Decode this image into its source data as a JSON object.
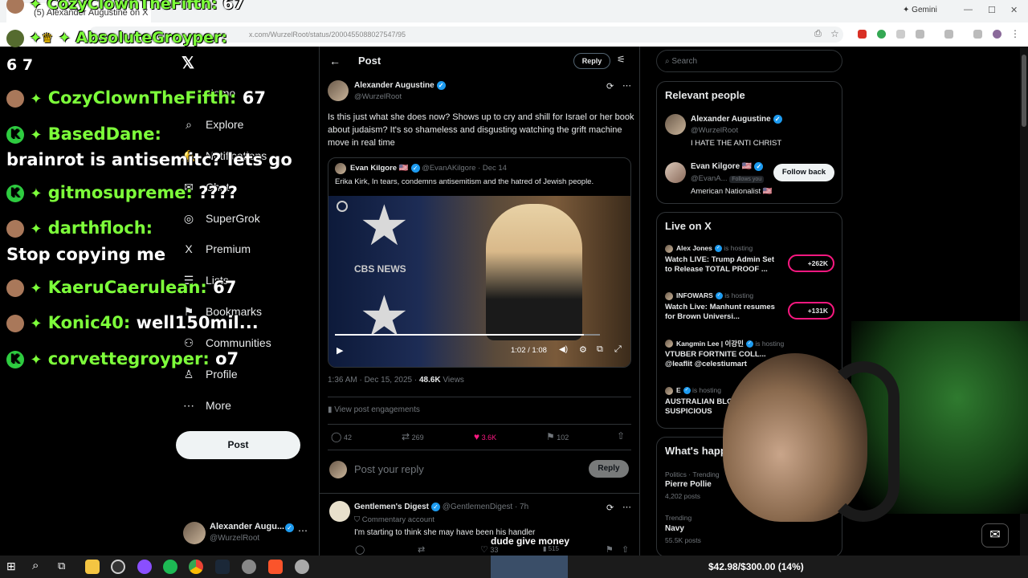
{
  "browser": {
    "tab_title": "(5) Alexander Augustine on X",
    "address": "x.com/WurzelRoot/status/2000455088027547/95",
    "gemini_label": "Gemini"
  },
  "nav": {
    "items": [
      {
        "label": "Home",
        "icon": "home-icon",
        "glyph": "⌂"
      },
      {
        "label": "Explore",
        "icon": "search-icon",
        "glyph": "⌕"
      },
      {
        "label": "Notifications",
        "icon": "bell-icon",
        "glyph": "🔔"
      },
      {
        "label": "Chat",
        "icon": "chat-icon",
        "glyph": "✉"
      },
      {
        "label": "SuperGrok",
        "icon": "grok-icon",
        "glyph": "◎"
      },
      {
        "label": "Premium",
        "icon": "x-icon",
        "glyph": "X"
      },
      {
        "label": "Lists",
        "icon": "list-icon",
        "glyph": "☰"
      },
      {
        "label": "Bookmarks",
        "icon": "bookmark-icon",
        "glyph": "⚑"
      },
      {
        "label": "Communities",
        "icon": "people-icon",
        "glyph": "⚇"
      },
      {
        "label": "Profile",
        "icon": "person-icon",
        "glyph": "♙"
      },
      {
        "label": "More",
        "icon": "more-icon",
        "glyph": "⋯"
      }
    ],
    "post_button": "Post",
    "account": {
      "name": "Alexander Augu...",
      "handle": "@WurzelRoot"
    }
  },
  "header": {
    "title": "Post",
    "reply_button": "Reply"
  },
  "post": {
    "author": "Alexander Augustine",
    "handle": "@WurzelRoot",
    "text": "Is this just what she does now? Shows up to cry and shill for Israel or her book about judaism? It's so shameless and disgusting watching the grift machine move in real time",
    "quote": {
      "author": "Evan Kilgore",
      "flag": "🇺🇸",
      "handle": "@EvanAKilgore",
      "date": "· Dec 14",
      "text": "Erika Kirk, In tears, condemns antisemitism and the hatred of Jewish people.",
      "video_brand": "CBS NEWS",
      "video_time": "1:02 / 1:08",
      "video_progress": 0.94
    },
    "timestamp": "1:36 AM · Dec 15, 2025 ·",
    "views_count": "48.6K",
    "views_label": "Views",
    "engagements": "View post engagements",
    "actions": {
      "replies": "42",
      "reposts": "269",
      "likes": "3.6K",
      "bookmarks": "102"
    },
    "reply_placeholder": "Post your reply",
    "reply_button": "Reply"
  },
  "reply_tweet": {
    "author": "Gentlemen's Digest",
    "handle": "@GentlemenDigest",
    "time": "· 7h",
    "badge": "Commentary account",
    "text": "I'm starting to think she may have been his handler",
    "actions": {
      "likes": "33",
      "views": "515"
    }
  },
  "caption": "dude give money",
  "search": {
    "placeholder": "Search"
  },
  "relevant": {
    "title": "Relevant people",
    "people": [
      {
        "name": "Alexander Augustine",
        "handle": "@WurzelRoot",
        "bio": "I HATE THE ANTI CHRIST"
      },
      {
        "name": "Evan Kilgore",
        "flag": "🇺🇸",
        "handle": "@EvanA...",
        "follows": "Follows you",
        "bio": "American Nationalist 🇺🇸",
        "button": "Follow back"
      }
    ]
  },
  "live": {
    "title": "Live on X",
    "items": [
      {
        "host": "Alex Jones",
        "status": "is hosting",
        "title": "Watch LIVE: Trump Admin Set to Release TOTAL PROOF ...",
        "count": "+262K"
      },
      {
        "host": "INFOWARS",
        "status": "is hosting",
        "title": "Watch Live: Manhunt resumes for Brown Universi...",
        "count": "+131K"
      },
      {
        "host": "Kangmin Lee | 이강민",
        "status": "is hosting",
        "title": "VTUBER FORTNITE COLL... @leaflit @celestiumart",
        "count": ""
      },
      {
        "host": "E",
        "status": "is hosting",
        "title": "AUSTRALIAN BLO... The SUSPICIOUS",
        "count": ""
      }
    ]
  },
  "happening": {
    "title": "What's happen",
    "items": [
      {
        "category": "Politics · Trending",
        "name": "Pierre Pollie",
        "posts": "4,202 posts"
      },
      {
        "category": "Trending",
        "name": "Navy",
        "posts": "55.5K posts"
      }
    ]
  },
  "chat": [
    {
      "user": "CozyClownTheFifth:",
      "msg": "67"
    },
    {
      "user": "AbsoluteGroyper:",
      "msg": "6 7"
    },
    {
      "user": "CozyClownTheFifth:",
      "msg": "67"
    },
    {
      "user": "BasedDane:",
      "msg": "brainrot is antisemitc? lets go"
    },
    {
      "user": "gitmosupreme:",
      "msg": "????"
    },
    {
      "user": "darthfloch:",
      "msg": "Stop copying me"
    },
    {
      "user": "KaeruCaerulean:",
      "msg": "67"
    },
    {
      "user": "Konic40:",
      "msg": "well150mil..."
    },
    {
      "user": "corvettegroyper:",
      "msg": "o7"
    }
  ],
  "taskbar": {
    "donation": "$42.98/$300.00 (14%)"
  },
  "colors": {
    "accent": "#1d9bf0",
    "like": "#f91880",
    "chat_name": "#7dff3a",
    "live_ring": "#f91880"
  }
}
